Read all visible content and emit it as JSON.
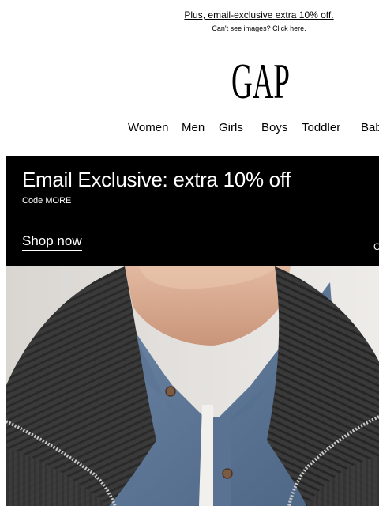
{
  "preheader": {
    "headline": "Plus, email-exclusive extra 10% off.",
    "cant_see": "Can't see images?",
    "click_here": "Click here",
    "period": "."
  },
  "brand": {
    "logo_text": "GAP"
  },
  "nav": {
    "items": [
      "Women",
      "Men",
      "Girls",
      "Boys",
      "Toddler",
      "Bab"
    ]
  },
  "banner": {
    "title": "Email Exclusive: extra 10% off",
    "code": "Code MORE",
    "cta": "Shop now",
    "edge_text": "C"
  },
  "hero": {
    "icon": "sweater-model-photo"
  },
  "colors": {
    "banner_bg": "#000000",
    "page_bg": "#ffffff",
    "text": "#000000"
  }
}
